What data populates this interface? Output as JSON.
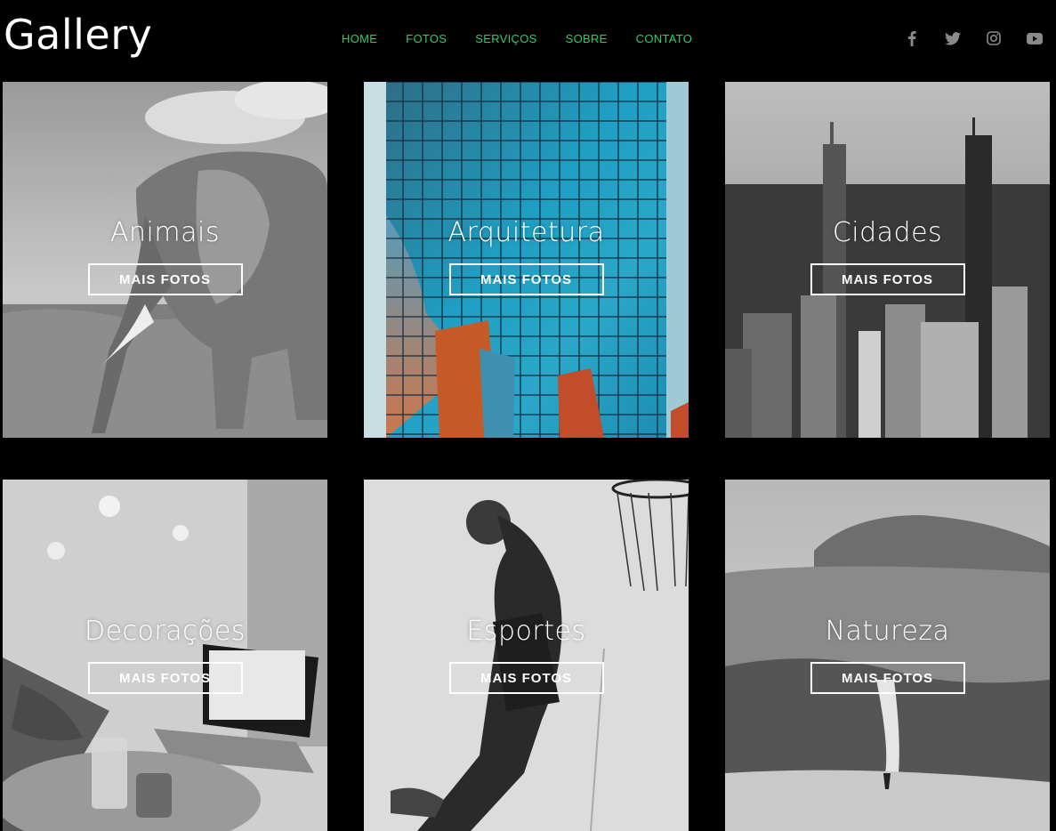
{
  "header": {
    "logo": "Gallery",
    "nav": [
      "HOME",
      "FOTOS",
      "SERVIÇOS",
      "SOBRE",
      "CONTATO"
    ],
    "social": [
      "facebook-icon",
      "twitter-icon",
      "instagram-icon",
      "youtube-icon"
    ],
    "colors": {
      "nav": "#2ecc71",
      "social": "#8a8a8a"
    }
  },
  "gallery": {
    "tiles": [
      {
        "title": "Animais",
        "button": "MAIS FOTOS"
      },
      {
        "title": "Arquitetura",
        "button": "MAIS FOTOS"
      },
      {
        "title": "Cidades",
        "button": "MAIS FOTOS"
      },
      {
        "title": "Decorações",
        "button": "MAIS FOTOS"
      },
      {
        "title": "Esportes",
        "button": "MAIS FOTOS"
      },
      {
        "title": "Natureza",
        "button": "MAIS FOTOS"
      }
    ]
  }
}
